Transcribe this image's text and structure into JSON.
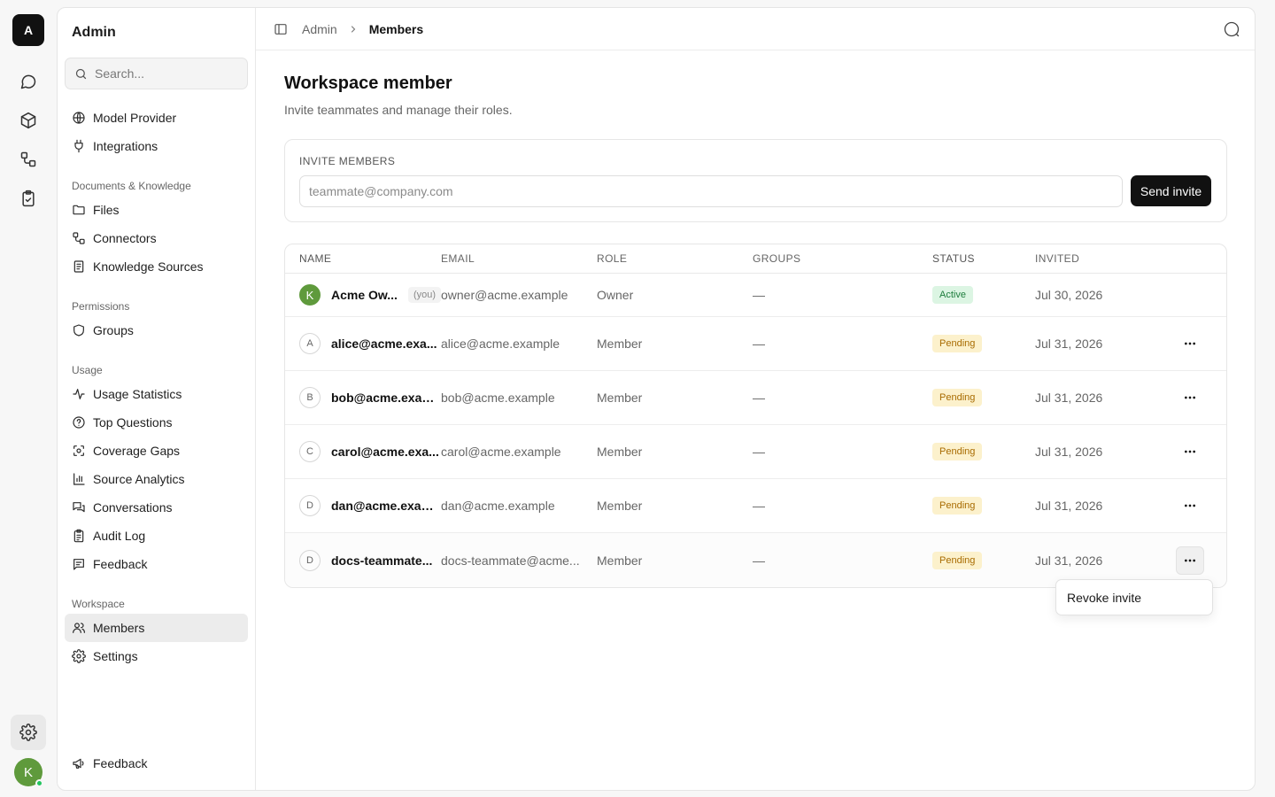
{
  "rail": {
    "logo_letter": "A",
    "icons": [
      "chat-bubble-icon",
      "cube-icon",
      "flow-icon",
      "clipboard-check-icon"
    ],
    "avatar_letter": "K"
  },
  "sidebar": {
    "title": "Admin",
    "search_placeholder": "Search...",
    "items_top": [
      {
        "label": "Model Provider",
        "icon": "globe-icon"
      },
      {
        "label": "Integrations",
        "icon": "plug-icon"
      }
    ],
    "groups": [
      {
        "label": "Documents & Knowledge",
        "items": [
          {
            "label": "Files",
            "icon": "folder-icon"
          },
          {
            "label": "Connectors",
            "icon": "connector-icon"
          },
          {
            "label": "Knowledge Sources",
            "icon": "document-icon"
          }
        ]
      },
      {
        "label": "Permissions",
        "items": [
          {
            "label": "Groups",
            "icon": "shield-icon"
          }
        ]
      },
      {
        "label": "Usage",
        "items": [
          {
            "label": "Usage Statistics",
            "icon": "activity-icon"
          },
          {
            "label": "Top Questions",
            "icon": "question-circle-icon"
          },
          {
            "label": "Coverage Gaps",
            "icon": "scan-icon"
          },
          {
            "label": "Source Analytics",
            "icon": "bar-chart-icon"
          },
          {
            "label": "Conversations",
            "icon": "messages-icon"
          },
          {
            "label": "Audit Log",
            "icon": "clipboard-list-icon"
          },
          {
            "label": "Feedback",
            "icon": "message-square-text-icon"
          }
        ]
      },
      {
        "label": "Workspace",
        "items": [
          {
            "label": "Members",
            "icon": "users-icon",
            "active": true
          },
          {
            "label": "Settings",
            "icon": "gear-icon"
          }
        ]
      }
    ],
    "footer_feedback": "Feedback"
  },
  "topbar": {
    "crumb_parent": "Admin",
    "crumb_current": "Members"
  },
  "page": {
    "title": "Workspace member",
    "subtitle": "Invite teammates and manage their roles."
  },
  "invite": {
    "label": "INVITE MEMBERS",
    "placeholder": "teammate@company.com",
    "button": "Send invite"
  },
  "table": {
    "headers": {
      "name": "NAME",
      "email": "EMAIL",
      "role": "ROLE",
      "groups": "GROUPS",
      "status": "STATUS",
      "invited": "INVITED"
    },
    "rows": [
      {
        "initial": "K",
        "name": "Acme Ow...",
        "you": "(you)",
        "email": "owner@acme.example",
        "role": "Owner",
        "groups": "—",
        "status": "Active",
        "invited": "Jul 30, 2026"
      },
      {
        "initial": "A",
        "name": "alice@acme.exa...",
        "email": "alice@acme.example",
        "role": "Member",
        "groups": "—",
        "status": "Pending",
        "invited": "Jul 31, 2026"
      },
      {
        "initial": "B",
        "name": "bob@acme.exam...",
        "email": "bob@acme.example",
        "role": "Member",
        "groups": "—",
        "status": "Pending",
        "invited": "Jul 31, 2026"
      },
      {
        "initial": "C",
        "name": "carol@acme.exa...",
        "email": "carol@acme.example",
        "role": "Member",
        "groups": "—",
        "status": "Pending",
        "invited": "Jul 31, 2026"
      },
      {
        "initial": "D",
        "name": "dan@acme.exam...",
        "email": "dan@acme.example",
        "role": "Member",
        "groups": "—",
        "status": "Pending",
        "invited": "Jul 31, 2026"
      },
      {
        "initial": "D",
        "name": "docs-teammate...",
        "email": "docs-teammate@acme...",
        "role": "Member",
        "groups": "—",
        "status": "Pending",
        "invited": "Jul 31, 2026"
      }
    ]
  },
  "row_menu": {
    "item": "Revoke invite"
  },
  "colors": {
    "accent": "#111111",
    "active_badge_bg": "#dcf5e3",
    "pending_badge_bg": "#fcf1cc",
    "avatar_green": "#5f9a3c"
  }
}
